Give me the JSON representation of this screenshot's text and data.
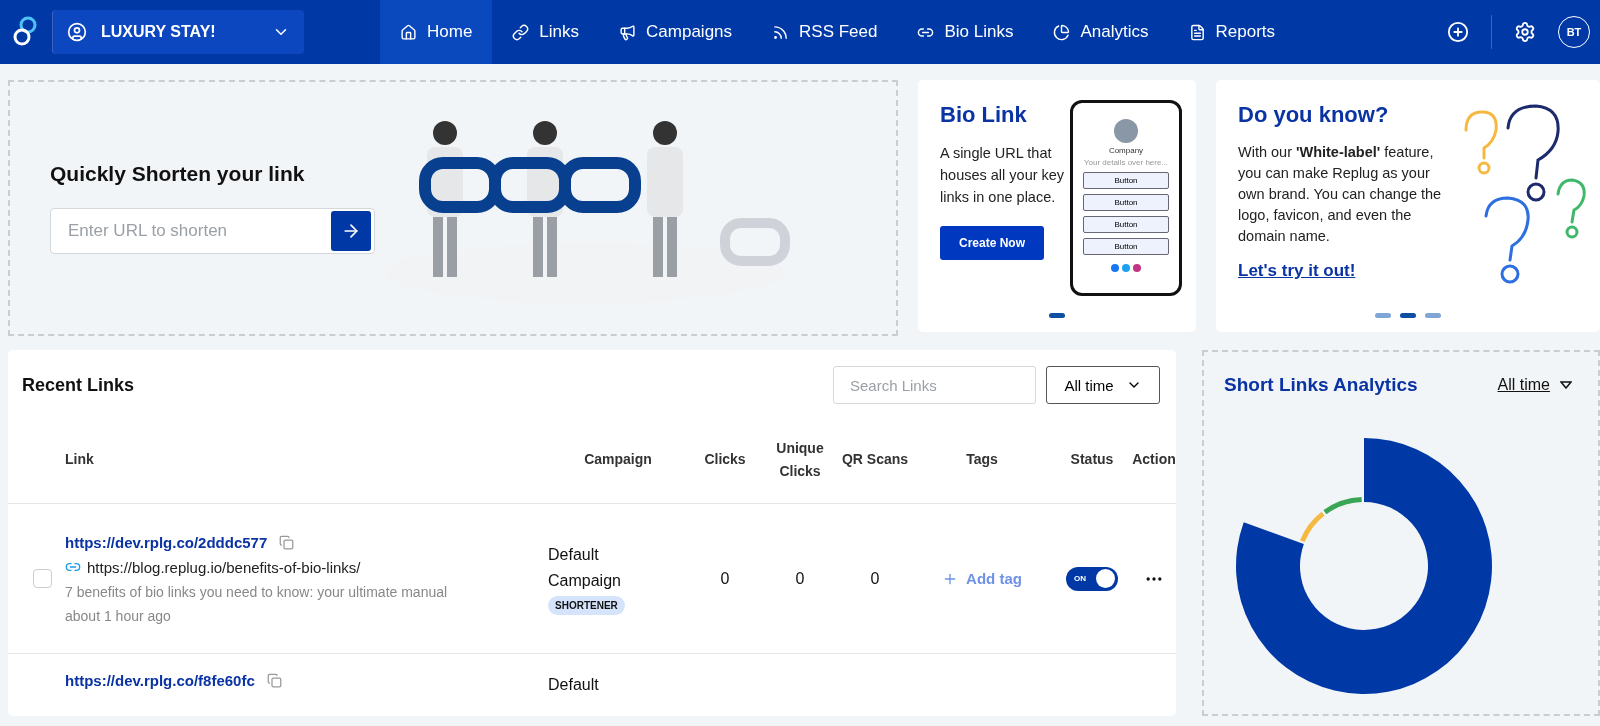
{
  "nav": {
    "workspace": "LUXURY STAY!",
    "items": [
      {
        "label": "Home",
        "selected": true
      },
      {
        "label": "Links",
        "selected": false
      },
      {
        "label": "Campaigns",
        "selected": false
      },
      {
        "label": "RSS Feed",
        "selected": false
      },
      {
        "label": "Bio Links",
        "selected": false
      },
      {
        "label": "Analytics",
        "selected": false
      },
      {
        "label": "Reports",
        "selected": false
      }
    ],
    "avatar": "BT"
  },
  "shorten": {
    "title": "Quickly Shorten your link",
    "placeholder": "Enter URL to shorten"
  },
  "bio_card": {
    "title": "Bio Link",
    "text": "A single URL that houses all your key links in one place.",
    "button": "Create Now",
    "phone": {
      "company": "Company",
      "subtitle": "Your details over here...",
      "buttons": [
        "Button",
        "Button",
        "Button",
        "Button"
      ]
    },
    "dots": [
      {
        "selected": true
      }
    ]
  },
  "tip_card": {
    "title": "Do you know?",
    "text": "With our **'White-label'** feature, you can make Replug as your own brand. You can change the logo, favicon, and even the domain name.",
    "link": "Let's try it out!",
    "dots": [
      {
        "selected": false
      },
      {
        "selected": true
      },
      {
        "selected": false
      }
    ]
  },
  "recent_links": {
    "title": "Recent Links",
    "search_placeholder": "Search Links",
    "period": "All time",
    "columns": [
      "Link",
      "Campaign",
      "Clicks",
      "Unique Clicks",
      "QR Scans",
      "Tags",
      "Status",
      "Action"
    ],
    "rows": [
      {
        "short_url": "https://dev.rplg.co/2dddc577",
        "long_url": "https://blog.replug.io/benefits-of-bio-links/",
        "description": "7 benefits of bio links you need to know: your ultimate manual",
        "time": "about 1 hour ago",
        "campaign": "Default Campaign",
        "tag": "SHORTENER",
        "clicks": "0",
        "unique_clicks": "0",
        "qr_scans": "0",
        "add_tag": "Add tag",
        "status": "ON",
        "on": true,
        "checked": false
      },
      {
        "short_url": "https://dev.rplg.co/f8fe60fc",
        "campaign": "Default"
      }
    ]
  },
  "analytics": {
    "title": "Short Links Analytics",
    "period": "All time"
  }
}
